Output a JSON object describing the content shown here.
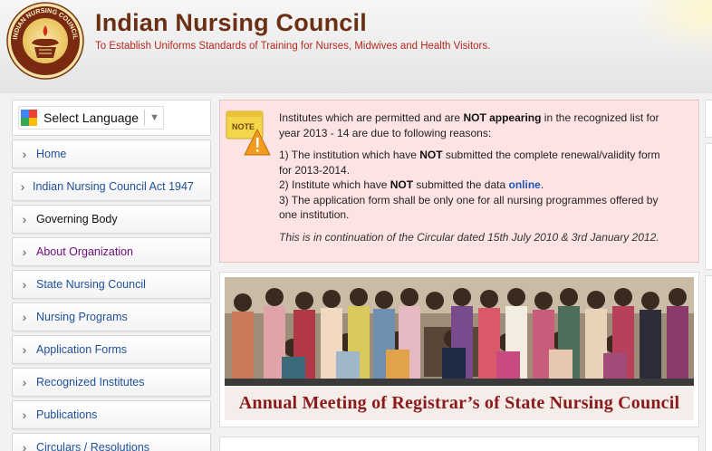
{
  "header": {
    "title": "Indian Nursing Council",
    "tagline": "To Establish Uniforms Standards of Training for Nurses, Midwives and Health Visitors.",
    "logo_text": "INDIAN NURSING COUNCIL"
  },
  "language": {
    "label": "Select Language",
    "caret": "▼"
  },
  "nav": [
    {
      "label": "Home",
      "state": "normal"
    },
    {
      "label": "Indian Nursing Council Act 1947",
      "state": "link"
    },
    {
      "label": "Governing Body",
      "state": "active"
    },
    {
      "label": "About Organization",
      "state": "visited"
    },
    {
      "label": "State Nursing Council",
      "state": "link"
    },
    {
      "label": "Nursing Programs",
      "state": "link"
    },
    {
      "label": "Application Forms",
      "state": "link"
    },
    {
      "label": "Recognized Institutes",
      "state": "link"
    },
    {
      "label": "Publications",
      "state": "link"
    },
    {
      "label": "Circulars / Resolutions",
      "state": "link"
    }
  ],
  "notice": {
    "icon_label": "NOTE",
    "intro_a": "Institutes which are permitted and are ",
    "intro_bold": "NOT appearing",
    "intro_b": " in the recognized list for year 2013 - 14 are due to following reasons:",
    "reason1_a": "1) The institution which have ",
    "reason1_bold": "NOT",
    "reason1_b": " submitted the complete renewal/validity form for 2013-2014.",
    "reason2_a": "2) Institute which have ",
    "reason2_bold": "NOT",
    "reason2_b": " submitted the data ",
    "reason2_link": "online",
    "reason2_c": ".",
    "reason3": "3) The application form shall be only one for all nursing programmes offered by one institution.",
    "footnote": "This is in continuation of the Circular dated 15th July 2010 & 3rd January 2012."
  },
  "banner": {
    "caption": "Annual Meeting of Registrar’s of State Nursing Council"
  },
  "colors": {
    "title": "#6b2f14",
    "tagline": "#b5281e",
    "link": "#1e4f9c",
    "visited": "#6d0c7a",
    "notice_bg": "#fde3e3",
    "caption": "#8b1a1a"
  }
}
